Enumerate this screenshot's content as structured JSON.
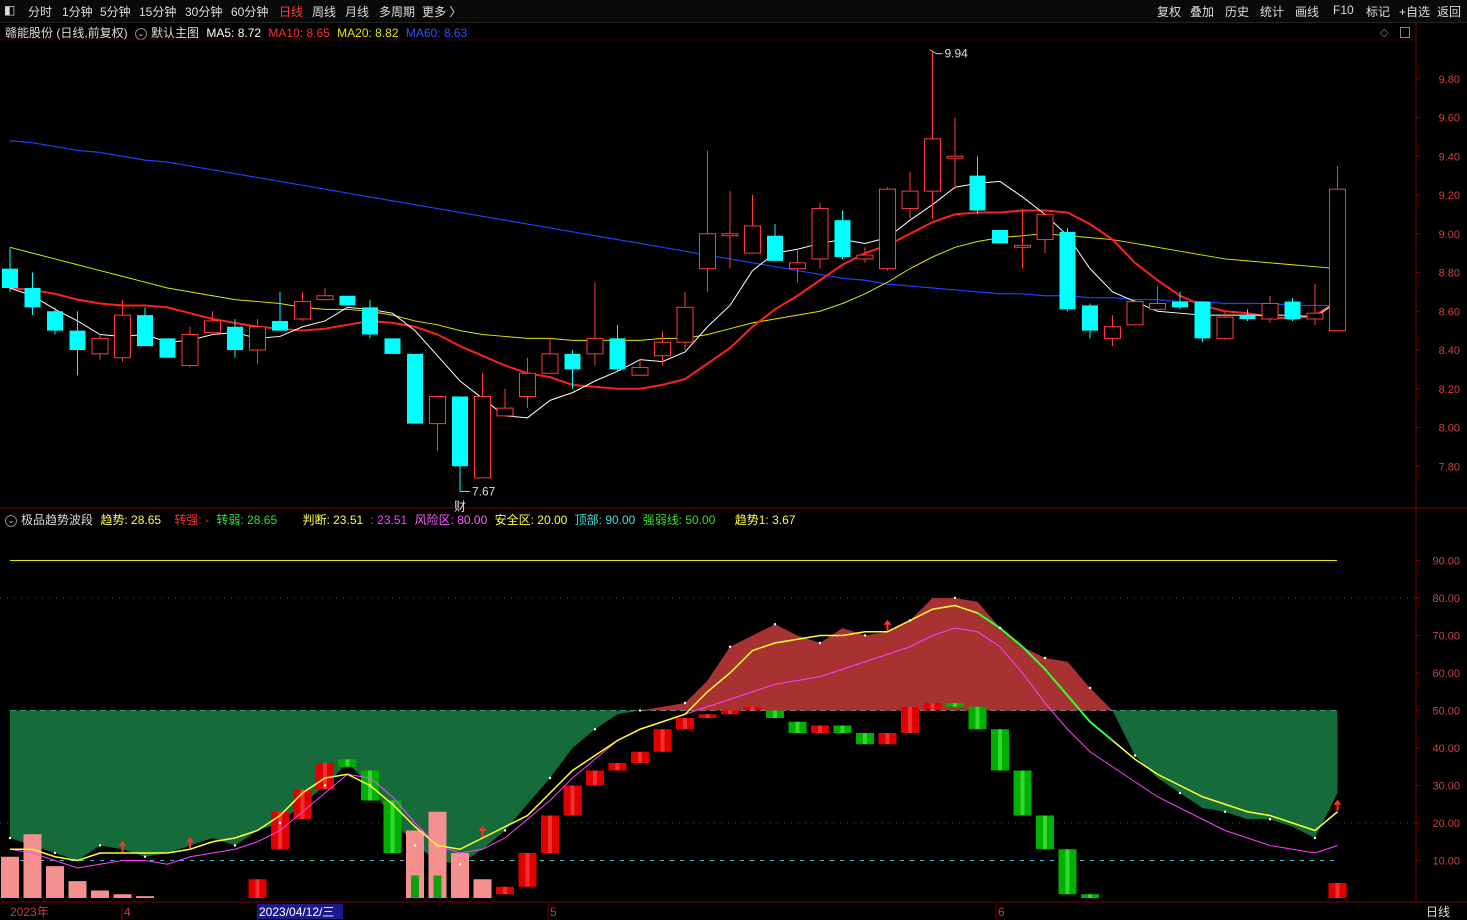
{
  "toolbar": {
    "left": [
      "分时",
      "1分钟",
      "5分钟",
      "15分钟",
      "30分钟",
      "60分钟",
      "日线",
      "周线",
      "月线",
      "多周期",
      "更多 〉"
    ],
    "active": "日线",
    "right": [
      "复权",
      "叠加",
      "历史",
      "统计",
      "画线",
      "F10",
      "标记",
      "+自选",
      "返回"
    ]
  },
  "main_legend": {
    "stock": "赣能股份 (日线,前复权)",
    "template": "默认主图",
    "ma5": "MA5: 8.72",
    "ma10": "MA10: 8.65",
    "ma20": "MA20: 8.82",
    "ma60": "MA60: 8.63"
  },
  "sub_legend": {
    "name": "极品趋势波段",
    "trend": "趋势: 28.65",
    "strong": "转强: -",
    "weak": "转弱: 28.65",
    "judge": "判断: 23.51",
    "colon": ": 23.51",
    "risk": "风险区: 80.00",
    "safe": "安全区: 20.00",
    "top": "顶部: 90.00",
    "line": "强弱线: 50.00",
    "trend1": "趋势1: 3.67"
  },
  "annotations": {
    "high": "9.94",
    "low": "7.67",
    "cai": "财"
  },
  "x_axis": {
    "labels": [
      "2023年",
      "4",
      "2023/04/12/三",
      "5",
      "6"
    ],
    "right_label": "日线"
  },
  "colors": {
    "up": "#ff3b3b",
    "down": "#00ffff",
    "ma5": "#ffffff",
    "ma10": "#ff2020",
    "ma20": "#e6e600",
    "ma60": "#2040ff",
    "green": "#00c800"
  },
  "chart_data": {
    "type": "candlestick",
    "y_ticks": [
      "9.80",
      "9.60",
      "9.40",
      "9.20",
      "9.00",
      "8.80",
      "8.60",
      "8.40",
      "8.20",
      "8.00",
      "7.80"
    ],
    "ylim": [
      7.6,
      10.0
    ],
    "candles": [
      {
        "o": 8.82,
        "h": 8.93,
        "l": 8.7,
        "c": 8.72
      },
      {
        "o": 8.72,
        "h": 8.8,
        "l": 8.58,
        "c": 8.62
      },
      {
        "o": 8.6,
        "h": 8.62,
        "l": 8.48,
        "c": 8.5
      },
      {
        "o": 8.5,
        "h": 8.6,
        "l": 8.27,
        "c": 8.4
      },
      {
        "o": 8.38,
        "h": 8.48,
        "l": 8.35,
        "c": 8.46
      },
      {
        "o": 8.36,
        "h": 8.66,
        "l": 8.34,
        "c": 8.58
      },
      {
        "o": 8.58,
        "h": 8.62,
        "l": 8.42,
        "c": 8.42
      },
      {
        "o": 8.46,
        "h": 8.46,
        "l": 8.36,
        "c": 8.36
      },
      {
        "o": 8.32,
        "h": 8.52,
        "l": 8.31,
        "c": 8.48
      },
      {
        "o": 8.49,
        "h": 8.6,
        "l": 8.48,
        "c": 8.55
      },
      {
        "o": 8.52,
        "h": 8.56,
        "l": 8.36,
        "c": 8.4
      },
      {
        "o": 8.4,
        "h": 8.56,
        "l": 8.33,
        "c": 8.52
      },
      {
        "o": 8.55,
        "h": 8.7,
        "l": 8.5,
        "c": 8.5
      },
      {
        "o": 8.56,
        "h": 8.7,
        "l": 8.55,
        "c": 8.65
      },
      {
        "o": 8.66,
        "h": 8.72,
        "l": 8.66,
        "c": 8.68
      },
      {
        "o": 8.68,
        "h": 8.68,
        "l": 8.63,
        "c": 8.63
      },
      {
        "o": 8.62,
        "h": 8.66,
        "l": 8.46,
        "c": 8.48
      },
      {
        "o": 8.46,
        "h": 8.46,
        "l": 8.38,
        "c": 8.38
      },
      {
        "o": 8.38,
        "h": 8.38,
        "l": 8.02,
        "c": 8.02
      },
      {
        "o": 8.02,
        "h": 8.16,
        "l": 7.88,
        "c": 8.16
      },
      {
        "o": 8.16,
        "h": 8.16,
        "l": 7.67,
        "c": 7.8
      },
      {
        "o": 7.74,
        "h": 8.28,
        "l": 7.74,
        "c": 8.16
      },
      {
        "o": 8.06,
        "h": 8.2,
        "l": 8.06,
        "c": 8.1
      },
      {
        "o": 8.16,
        "h": 8.36,
        "l": 8.1,
        "c": 8.28
      },
      {
        "o": 8.28,
        "h": 8.46,
        "l": 8.28,
        "c": 8.38
      },
      {
        "o": 8.38,
        "h": 8.4,
        "l": 8.2,
        "c": 8.3
      },
      {
        "o": 8.38,
        "h": 8.75,
        "l": 8.32,
        "c": 8.46
      },
      {
        "o": 8.46,
        "h": 8.53,
        "l": 8.29,
        "c": 8.3
      },
      {
        "o": 8.27,
        "h": 8.35,
        "l": 8.27,
        "c": 8.31
      },
      {
        "o": 8.37,
        "h": 8.5,
        "l": 8.32,
        "c": 8.44
      },
      {
        "o": 8.44,
        "h": 8.7,
        "l": 8.4,
        "c": 8.62
      },
      {
        "o": 8.82,
        "h": 9.43,
        "l": 8.7,
        "c": 9.0
      },
      {
        "o": 8.99,
        "h": 9.22,
        "l": 8.82,
        "c": 9.0
      },
      {
        "o": 8.9,
        "h": 9.2,
        "l": 8.9,
        "c": 9.04
      },
      {
        "o": 8.99,
        "h": 9.05,
        "l": 8.86,
        "c": 8.86
      },
      {
        "o": 8.82,
        "h": 8.92,
        "l": 8.75,
        "c": 8.85
      },
      {
        "o": 8.87,
        "h": 9.16,
        "l": 8.82,
        "c": 9.13
      },
      {
        "o": 9.07,
        "h": 9.12,
        "l": 8.87,
        "c": 8.88
      },
      {
        "o": 8.87,
        "h": 8.93,
        "l": 8.85,
        "c": 8.89
      },
      {
        "o": 8.82,
        "h": 9.24,
        "l": 8.81,
        "c": 9.23
      },
      {
        "o": 9.13,
        "h": 9.32,
        "l": 9.08,
        "c": 9.22
      },
      {
        "o": 9.22,
        "h": 9.94,
        "l": 9.08,
        "c": 9.49
      },
      {
        "o": 9.39,
        "h": 9.6,
        "l": 9.23,
        "c": 9.4
      },
      {
        "o": 9.3,
        "h": 9.4,
        "l": 9.1,
        "c": 9.12
      },
      {
        "o": 9.02,
        "h": 9.02,
        "l": 8.95,
        "c": 8.95
      },
      {
        "o": 8.93,
        "h": 9.13,
        "l": 8.82,
        "c": 8.94
      },
      {
        "o": 8.97,
        "h": 9.07,
        "l": 8.9,
        "c": 9.1
      },
      {
        "o": 9.01,
        "h": 9.03,
        "l": 8.6,
        "c": 8.61
      },
      {
        "o": 8.63,
        "h": 8.64,
        "l": 8.46,
        "c": 8.5
      },
      {
        "o": 8.46,
        "h": 8.58,
        "l": 8.42,
        "c": 8.52
      },
      {
        "o": 8.53,
        "h": 8.66,
        "l": 8.53,
        "c": 8.65
      },
      {
        "o": 8.61,
        "h": 8.73,
        "l": 8.61,
        "c": 8.64
      },
      {
        "o": 8.65,
        "h": 8.7,
        "l": 8.61,
        "c": 8.62
      },
      {
        "o": 8.65,
        "h": 8.65,
        "l": 8.44,
        "c": 8.46
      },
      {
        "o": 8.46,
        "h": 8.6,
        "l": 8.45,
        "c": 8.57
      },
      {
        "o": 8.58,
        "h": 8.61,
        "l": 8.55,
        "c": 8.56
      },
      {
        "o": 8.56,
        "h": 8.68,
        "l": 8.54,
        "c": 8.64
      },
      {
        "o": 8.65,
        "h": 8.67,
        "l": 8.55,
        "c": 8.56
      },
      {
        "o": 8.56,
        "h": 8.74,
        "l": 8.53,
        "c": 8.59
      },
      {
        "o": 8.5,
        "h": 9.35,
        "l": 8.5,
        "c": 9.23
      }
    ],
    "ma5": [
      8.72,
      8.68,
      8.61,
      8.55,
      8.48,
      8.47,
      8.48,
      8.44,
      8.45,
      8.48,
      8.49,
      8.46,
      8.47,
      8.52,
      8.55,
      8.62,
      8.61,
      8.59,
      8.5,
      8.37,
      8.24,
      8.15,
      8.06,
      8.05,
      8.14,
      8.18,
      8.24,
      8.29,
      8.35,
      8.34,
      8.39,
      8.52,
      8.63,
      8.81,
      8.9,
      8.92,
      8.95,
      8.97,
      8.95,
      8.98,
      9.07,
      9.15,
      9.24,
      9.26,
      9.27,
      9.19,
      9.1,
      8.99,
      8.82,
      8.7,
      8.65,
      8.6,
      8.59,
      8.58,
      8.58,
      8.58,
      8.58,
      8.58,
      8.57,
      8.65
    ],
    "ma10": [
      8.72,
      8.71,
      8.69,
      8.66,
      8.64,
      8.63,
      8.63,
      8.62,
      8.59,
      8.56,
      8.54,
      8.52,
      8.51,
      8.5,
      8.51,
      8.53,
      8.55,
      8.54,
      8.52,
      8.48,
      8.42,
      8.37,
      8.32,
      8.28,
      8.26,
      8.22,
      8.21,
      8.2,
      8.2,
      8.22,
      8.25,
      8.33,
      8.41,
      8.52,
      8.61,
      8.68,
      8.76,
      8.84,
      8.9,
      8.94,
      9.0,
      9.06,
      9.1,
      9.11,
      9.11,
      9.12,
      9.12,
      9.11,
      9.05,
      8.97,
      8.85,
      8.76,
      8.68,
      8.63,
      8.6,
      8.59,
      8.57,
      8.56,
      8.58,
      8.65
    ],
    "ma20": [
      8.93,
      8.9,
      8.87,
      8.84,
      8.81,
      8.78,
      8.75,
      8.72,
      8.7,
      8.68,
      8.66,
      8.65,
      8.64,
      8.62,
      8.61,
      8.61,
      8.6,
      8.58,
      8.55,
      8.53,
      8.5,
      8.48,
      8.47,
      8.46,
      8.46,
      8.45,
      8.45,
      8.45,
      8.45,
      8.46,
      8.46,
      8.48,
      8.51,
      8.54,
      8.56,
      8.58,
      8.6,
      8.64,
      8.69,
      8.75,
      8.82,
      8.88,
      8.93,
      8.96,
      8.98,
      8.99,
      9.0,
      8.99,
      8.98,
      8.97,
      8.95,
      8.93,
      8.91,
      8.89,
      8.87,
      8.86,
      8.85,
      8.84,
      8.83,
      8.82
    ],
    "ma60": [
      9.48,
      9.47,
      9.45,
      9.43,
      9.42,
      9.4,
      9.38,
      9.37,
      9.35,
      9.33,
      9.31,
      9.29,
      9.27,
      9.25,
      9.23,
      9.21,
      9.19,
      9.17,
      9.15,
      9.13,
      9.11,
      9.09,
      9.07,
      9.05,
      9.03,
      9.01,
      8.99,
      8.97,
      8.95,
      8.93,
      8.91,
      8.89,
      8.87,
      8.85,
      8.83,
      8.81,
      8.79,
      8.77,
      8.76,
      8.74,
      8.73,
      8.72,
      8.71,
      8.7,
      8.69,
      8.69,
      8.68,
      8.68,
      8.67,
      8.67,
      8.66,
      8.66,
      8.65,
      8.65,
      8.64,
      8.64,
      8.64,
      8.63,
      8.63,
      8.63
    ],
    "sub": {
      "y_ticks": [
        "90.00",
        "80.00",
        "70.00",
        "60.00",
        "50.00",
        "40.00",
        "30.00",
        "20.00",
        "10.00"
      ],
      "ylim": [
        0,
        100
      ],
      "fill": [
        16,
        14,
        12,
        10,
        14,
        13,
        11,
        12,
        14,
        16,
        14,
        18,
        20,
        25,
        30,
        36,
        30,
        21,
        14,
        10,
        9,
        13,
        18,
        25,
        32,
        40,
        45,
        49,
        50,
        51,
        52,
        58,
        67,
        70,
        73,
        70,
        68,
        72,
        70,
        71,
        74,
        80,
        80,
        79,
        72,
        67,
        64,
        63,
        56,
        50,
        38,
        32,
        28,
        24,
        23,
        21,
        21,
        19,
        16,
        28
      ],
      "trend": [
        13,
        13,
        11,
        10,
        12,
        12,
        12,
        12,
        13,
        15,
        16,
        18,
        22,
        28,
        32,
        33,
        30,
        25,
        19,
        14,
        13,
        16,
        19,
        22,
        28,
        34,
        38,
        42,
        45,
        47,
        49,
        55,
        60,
        66,
        68,
        69,
        70,
        70,
        71,
        71,
        74,
        77,
        78,
        76,
        72,
        67,
        61,
        54,
        47,
        42,
        37,
        33,
        30,
        27,
        25,
        23,
        22,
        20,
        18,
        23
      ],
      "trend2": [
        13,
        12,
        10,
        8,
        9,
        10,
        10,
        9,
        11,
        12,
        13,
        15,
        18,
        23,
        28,
        33,
        32,
        27,
        20,
        14,
        12,
        13,
        16,
        21,
        26,
        32,
        37,
        42,
        45,
        47,
        49,
        51,
        53,
        55,
        57,
        58,
        59,
        61,
        63,
        65,
        67,
        70,
        72,
        71,
        67,
        60,
        52,
        45,
        39,
        35,
        31,
        27,
        24,
        21,
        18,
        16,
        14,
        13,
        12,
        14
      ],
      "bars": [
        {
          "t": "pink",
          "v": 11
        },
        {
          "t": "pink",
          "v": 17
        },
        {
          "t": "pink",
          "v": 8.5
        },
        {
          "t": "pink",
          "v": 4.5
        },
        {
          "t": "pink",
          "v": 2
        },
        {
          "t": "pink",
          "v": 1
        },
        {
          "t": "pink",
          "v": 0.5
        },
        {
          "t": "none",
          "v": 0
        },
        {
          "t": "none",
          "v": 0
        },
        {
          "t": "none",
          "v": 0
        },
        {
          "t": "none",
          "v": 0
        },
        {
          "t": "red",
          "o": 0,
          "c": 5
        },
        {
          "t": "red",
          "o": 13,
          "c": 23
        },
        {
          "t": "red",
          "o": 21,
          "c": 29
        },
        {
          "t": "red",
          "o": 29,
          "c": 36
        },
        {
          "t": "green",
          "o": 37,
          "c": 35
        },
        {
          "t": "green",
          "o": 34,
          "c": 26
        },
        {
          "t": "green",
          "o": 26,
          "c": 12
        },
        {
          "t": "pinkred",
          "v": 18
        },
        {
          "t": "pinkred",
          "v": 23
        },
        {
          "t": "pink",
          "v": 12
        },
        {
          "t": "pink",
          "v": 5
        },
        {
          "t": "red",
          "o": 1,
          "c": 3
        },
        {
          "t": "red",
          "o": 3,
          "c": 12
        },
        {
          "t": "red",
          "o": 12,
          "c": 22
        },
        {
          "t": "red",
          "o": 22,
          "c": 30
        },
        {
          "t": "red",
          "o": 30,
          "c": 34
        },
        {
          "t": "red",
          "o": 34,
          "c": 36
        },
        {
          "t": "red",
          "o": 36,
          "c": 39
        },
        {
          "t": "red",
          "o": 39,
          "c": 45
        },
        {
          "t": "red",
          "o": 45,
          "c": 48
        },
        {
          "t": "red",
          "o": 48,
          "c": 49
        },
        {
          "t": "red",
          "o": 49,
          "c": 50
        },
        {
          "t": "red",
          "o": 50,
          "c": 51
        },
        {
          "t": "green",
          "o": 50,
          "c": 48
        },
        {
          "t": "green",
          "o": 47,
          "c": 44
        },
        {
          "t": "red",
          "o": 44,
          "c": 46
        },
        {
          "t": "green",
          "o": 46,
          "c": 44
        },
        {
          "t": "green",
          "o": 44,
          "c": 41
        },
        {
          "t": "red",
          "o": 41,
          "c": 44
        },
        {
          "t": "red",
          "o": 44,
          "c": 51
        },
        {
          "t": "red",
          "o": 50,
          "c": 52
        },
        {
          "t": "green",
          "o": 52,
          "c": 51
        },
        {
          "t": "green",
          "o": 51,
          "c": 45
        },
        {
          "t": "green",
          "o": 45,
          "c": 34
        },
        {
          "t": "green",
          "o": 34,
          "c": 22
        },
        {
          "t": "green",
          "o": 22,
          "c": 13
        },
        {
          "t": "green",
          "o": 13,
          "c": 1
        },
        {
          "t": "green",
          "o": 1,
          "c": 0
        },
        {
          "t": "none",
          "v": 0
        },
        {
          "t": "none",
          "v": 0
        },
        {
          "t": "none",
          "v": 0
        },
        {
          "t": "none",
          "v": 0
        },
        {
          "t": "none",
          "v": 0
        },
        {
          "t": "none",
          "v": 0
        },
        {
          "t": "none",
          "v": 0
        },
        {
          "t": "none",
          "v": 0
        },
        {
          "t": "none",
          "v": 0
        },
        {
          "t": "none",
          "v": 0
        },
        {
          "t": "red",
          "o": 0,
          "c": 4
        }
      ]
    }
  }
}
